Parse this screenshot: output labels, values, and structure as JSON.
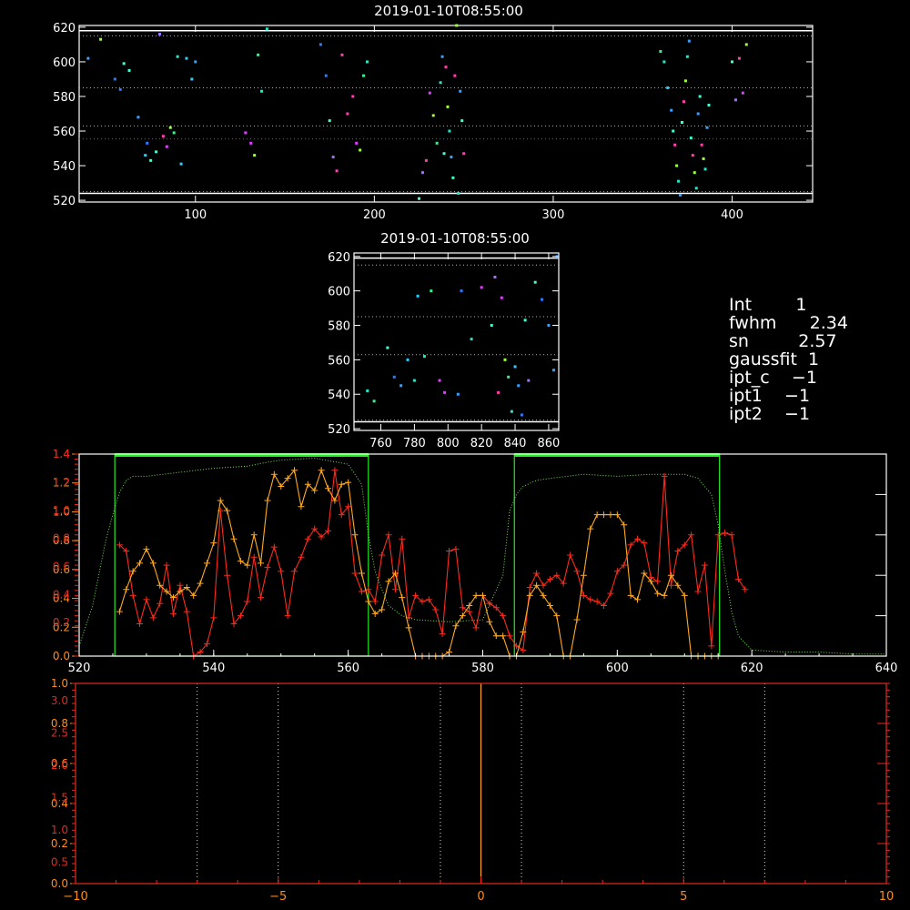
{
  "colors": {
    "background": "#000000",
    "axis_white": "#ffffff",
    "axis_orange": "#ff8c1a",
    "axis_red": "#e8281e",
    "series_red": "#ff2a1a",
    "series_orange": "#ffaa22",
    "dotted_green": "#7ce05a",
    "box_green": "#22ee22",
    "guide_yellow": "#ffe08a"
  },
  "info": {
    "int": "Int        1",
    "fwhm": "fwhm      2.34",
    "sn": "sn         2.57",
    "gaussfit": "gaussfit  1",
    "ipt_c": "ipt_c    −1",
    "ipt1": "ipt1    −1",
    "ipt2": "ipt2    −1"
  },
  "chart_data": [
    {
      "type": "scatter",
      "title": "2019-01-10T08:55:00",
      "xlim": [
        35,
        445
      ],
      "ylim": [
        519,
        621
      ],
      "x_ticks": [
        "100",
        "200",
        "300",
        "400"
      ],
      "x_tick_values": [
        100,
        200,
        300,
        400
      ],
      "y_ticks": [
        "520",
        "540",
        "560",
        "580",
        "600",
        "620"
      ],
      "y_tick_values": [
        520,
        540,
        560,
        580,
        600,
        620
      ],
      "hlines_white": [
        524,
        618
      ],
      "hlines_green_dotted": [
        615,
        585,
        563,
        525
      ],
      "hlines_red_dotted": [
        555.5
      ],
      "points": [
        [
          40,
          602
        ],
        [
          47,
          613
        ],
        [
          55,
          590
        ],
        [
          58,
          584
        ],
        [
          60,
          599
        ],
        [
          63,
          595
        ],
        [
          68,
          568
        ],
        [
          72,
          546
        ],
        [
          73,
          553
        ],
        [
          75,
          543
        ],
        [
          78,
          548
        ],
        [
          80,
          616
        ],
        [
          82,
          557
        ],
        [
          84,
          551
        ],
        [
          86,
          562
        ],
        [
          88,
          559
        ],
        [
          90,
          603
        ],
        [
          92,
          541
        ],
        [
          95,
          602
        ],
        [
          98,
          590
        ],
        [
          100,
          600
        ],
        [
          128,
          559
        ],
        [
          131,
          553
        ],
        [
          133,
          546
        ],
        [
          135,
          604
        ],
        [
          137,
          583
        ],
        [
          140,
          619
        ],
        [
          170,
          610
        ],
        [
          173,
          592
        ],
        [
          175,
          566
        ],
        [
          177,
          545
        ],
        [
          179,
          537
        ],
        [
          182,
          604
        ],
        [
          185,
          570
        ],
        [
          188,
          580
        ],
        [
          190,
          553
        ],
        [
          192,
          549
        ],
        [
          194,
          592
        ],
        [
          196,
          600
        ],
        [
          225,
          521
        ],
        [
          227,
          536
        ],
        [
          229,
          543
        ],
        [
          231,
          582
        ],
        [
          233,
          569
        ],
        [
          235,
          553
        ],
        [
          237,
          588
        ],
        [
          238,
          603
        ],
        [
          239,
          547
        ],
        [
          240,
          597
        ],
        [
          241,
          574
        ],
        [
          242,
          560
        ],
        [
          243,
          545
        ],
        [
          244,
          533
        ],
        [
          245,
          592
        ],
        [
          246,
          621
        ],
        [
          247,
          524
        ],
        [
          248,
          583
        ],
        [
          249,
          566
        ],
        [
          250,
          547
        ],
        [
          360,
          606
        ],
        [
          362,
          600
        ],
        [
          364,
          585
        ],
        [
          366,
          572
        ],
        [
          367,
          560
        ],
        [
          368,
          552
        ],
        [
          369,
          540
        ],
        [
          370,
          531
        ],
        [
          371,
          523
        ],
        [
          372,
          565
        ],
        [
          373,
          577
        ],
        [
          374,
          589
        ],
        [
          375,
          603
        ],
        [
          376,
          612
        ],
        [
          377,
          556
        ],
        [
          378,
          546
        ],
        [
          379,
          536
        ],
        [
          380,
          527
        ],
        [
          381,
          570
        ],
        [
          382,
          580
        ],
        [
          383,
          552
        ],
        [
          384,
          544
        ],
        [
          385,
          538
        ],
        [
          386,
          562
        ],
        [
          387,
          575
        ],
        [
          400,
          600
        ],
        [
          402,
          578
        ],
        [
          404,
          602
        ],
        [
          406,
          582
        ],
        [
          408,
          610
        ]
      ]
    },
    {
      "type": "scatter",
      "title": "2019-01-10T08:55:00",
      "xlim": [
        744,
        866
      ],
      "ylim": [
        519,
        622
      ],
      "x_ticks": [
        "760",
        "780",
        "800",
        "820",
        "840",
        "860"
      ],
      "x_tick_values": [
        760,
        780,
        800,
        820,
        840,
        860
      ],
      "y_ticks": [
        "520",
        "540",
        "560",
        "580",
        "600",
        "620"
      ],
      "y_tick_values": [
        520,
        540,
        560,
        580,
        600,
        620
      ],
      "hlines_white": [
        524,
        619
      ],
      "hlines_green_dotted": [
        615,
        585,
        563,
        525
      ],
      "points": [
        [
          752,
          542
        ],
        [
          756,
          536
        ],
        [
          764,
          567
        ],
        [
          768,
          550
        ],
        [
          772,
          545
        ],
        [
          776,
          560
        ],
        [
          780,
          548
        ],
        [
          782,
          597
        ],
        [
          786,
          562
        ],
        [
          790,
          600
        ],
        [
          795,
          548
        ],
        [
          798,
          541
        ],
        [
          806,
          540
        ],
        [
          808,
          600
        ],
        [
          814,
          572
        ],
        [
          820,
          602
        ],
        [
          826,
          580
        ],
        [
          828,
          608
        ],
        [
          830,
          541
        ],
        [
          832,
          596
        ],
        [
          834,
          560
        ],
        [
          836,
          550
        ],
        [
          838,
          530
        ],
        [
          840,
          556
        ],
        [
          842,
          545
        ],
        [
          844,
          528
        ],
        [
          846,
          583
        ],
        [
          848,
          548
        ],
        [
          852,
          605
        ],
        [
          856,
          595
        ],
        [
          860,
          580
        ],
        [
          863,
          554
        ],
        [
          865,
          620
        ]
      ]
    },
    {
      "type": "line",
      "xlim": [
        520,
        640
      ],
      "ylim": [
        0,
        1.0
      ],
      "x_ticks": [
        "520",
        "540",
        "560",
        "580",
        "600",
        "620",
        "640"
      ],
      "x_tick_values": [
        520,
        540,
        560,
        580,
        600,
        620,
        640
      ],
      "y_ticks_left_orange": [
        "0.0",
        "0.2",
        "0.4",
        "0.6",
        "0.8",
        "1.0",
        "1.2",
        "1.4"
      ],
      "y_ticks_left_red": [
        "0.2",
        "0.4",
        "0.6",
        "0.8",
        "1.0",
        "1.2",
        "1.4"
      ],
      "boxes": [
        [
          525.3,
          563.0
        ],
        [
          584.7,
          615.2
        ]
      ],
      "series": [
        {
          "color": "red",
          "x": [
            526,
            527,
            528,
            529,
            530,
            531,
            532,
            533,
            534,
            535,
            536,
            537,
            538,
            539,
            540,
            541,
            542,
            543,
            544,
            545,
            546,
            547,
            548,
            549,
            550,
            551,
            552,
            553,
            554,
            555,
            556,
            557,
            558,
            559,
            560,
            561,
            562,
            563,
            564,
            565,
            566,
            567,
            568,
            569,
            570,
            571,
            572,
            573,
            574,
            575,
            576,
            577,
            578,
            579,
            580,
            581,
            582,
            583,
            584,
            585,
            586,
            587,
            588,
            589,
            590,
            591,
            592,
            593,
            594,
            595,
            596,
            597,
            598,
            599,
            600,
            601,
            602,
            603,
            604,
            605,
            606,
            607,
            608,
            609,
            610,
            611,
            612,
            613,
            614,
            615,
            616,
            617,
            618,
            619
          ],
          "y": [
            0.55,
            0.52,
            0.3,
            0.16,
            0.28,
            0.19,
            0.26,
            0.45,
            0.21,
            0.35,
            0.22,
            0.0,
            0.02,
            0.06,
            0.19,
            0.72,
            0.4,
            0.16,
            0.2,
            0.27,
            0.49,
            0.29,
            0.44,
            0.54,
            0.42,
            0.2,
            0.42,
            0.49,
            0.58,
            0.63,
            0.59,
            0.62,
            0.92,
            0.7,
            0.74,
            0.41,
            0.32,
            0.33,
            0.27,
            0.5,
            0.6,
            0.33,
            0.58,
            0.19,
            0.3,
            0.27,
            0.28,
            0.23,
            0.11,
            0.52,
            0.53,
            0.24,
            0.22,
            0.14,
            0.3,
            0.26,
            0.24,
            0.2,
            0.1,
            0.05,
            0.03,
            0.34,
            0.41,
            0.35,
            0.38,
            0.4,
            0.36,
            0.5,
            0.42,
            0.3,
            0.28,
            0.27,
            0.25,
            0.31,
            0.42,
            0.45,
            0.55,
            0.58,
            0.56,
            0.39,
            0.37,
            0.89,
            0.35,
            0.52,
            0.55,
            0.6,
            0.32,
            0.45,
            0.05,
            0.6,
            0.61,
            0.6,
            0.38,
            0.33
          ]
        },
        {
          "color": "orange",
          "x": [
            526,
            527,
            528,
            529,
            530,
            531,
            532,
            533,
            534,
            535,
            536,
            537,
            538,
            539,
            540,
            541,
            542,
            543,
            544,
            545,
            546,
            547,
            548,
            549,
            550,
            551,
            552,
            553,
            554,
            555,
            556,
            557,
            558,
            559,
            560,
            561,
            562,
            563,
            564,
            565,
            566,
            567,
            568,
            569,
            570,
            571,
            572,
            573,
            574,
            575,
            576,
            577,
            578,
            579,
            580,
            581,
            582,
            583,
            584,
            585,
            586,
            587,
            588,
            589,
            590,
            591,
            592,
            593,
            594,
            595,
            596,
            597,
            598,
            599,
            600,
            601,
            602,
            603,
            604,
            605,
            606,
            607,
            608,
            609,
            610,
            611,
            612,
            613,
            614,
            615
          ],
          "y": [
            0.22,
            0.33,
            0.42,
            0.46,
            0.53,
            0.46,
            0.35,
            0.32,
            0.29,
            0.32,
            0.34,
            0.3,
            0.36,
            0.46,
            0.56,
            0.77,
            0.72,
            0.58,
            0.47,
            0.45,
            0.6,
            0.46,
            0.77,
            0.9,
            0.84,
            0.88,
            0.92,
            0.74,
            0.85,
            0.82,
            0.92,
            0.83,
            0.77,
            0.85,
            0.86,
            0.6,
            0.41,
            0.27,
            0.21,
            0.23,
            0.37,
            0.41,
            0.29,
            0.14,
            0.0,
            0.0,
            0.0,
            0.0,
            0.0,
            0.02,
            0.15,
            0.2,
            0.25,
            0.3,
            0.3,
            0.17,
            0.1,
            0.1,
            0.0,
            0.0,
            0.12,
            0.3,
            0.35,
            0.3,
            0.25,
            0.2,
            0.0,
            0.0,
            0.18,
            0.4,
            0.63,
            0.7,
            0.7,
            0.7,
            0.7,
            0.65,
            0.3,
            0.28,
            0.41,
            0.37,
            0.31,
            0.3,
            0.4,
            0.35,
            0.3,
            0.0,
            0.0,
            0.0,
            0.0,
            0.0
          ]
        },
        {
          "color": "green-dotted",
          "x": [
            520,
            522,
            524,
            525,
            526,
            527,
            528,
            530,
            535,
            540,
            545,
            548,
            550,
            555,
            560,
            562,
            563,
            564,
            565,
            566,
            568,
            570,
            575,
            580,
            583,
            584,
            585,
            586,
            588,
            590,
            595,
            600,
            605,
            610,
            612,
            614,
            615,
            616,
            617,
            618,
            620,
            625,
            630,
            635,
            640
          ],
          "y": [
            0.05,
            0.25,
            0.58,
            0.7,
            0.81,
            0.87,
            0.89,
            0.89,
            0.91,
            0.93,
            0.94,
            0.96,
            0.97,
            0.98,
            0.95,
            0.85,
            0.6,
            0.42,
            0.33,
            0.25,
            0.2,
            0.18,
            0.17,
            0.18,
            0.4,
            0.72,
            0.8,
            0.84,
            0.87,
            0.88,
            0.9,
            0.89,
            0.9,
            0.9,
            0.88,
            0.8,
            0.65,
            0.42,
            0.22,
            0.1,
            0.03,
            0.02,
            0.02,
            0.01,
            0.01
          ]
        }
      ]
    },
    {
      "type": "line",
      "xlim": [
        -10,
        10
      ],
      "ylim": [
        0,
        1.0
      ],
      "x_ticks": [
        "−10",
        "−5",
        "0",
        "5",
        "10"
      ],
      "x_tick_values": [
        -10,
        -5,
        0,
        5,
        10
      ],
      "y_ticks_left_orange": [
        "0.0",
        "0.2",
        "0.4",
        "0.6",
        "0.8",
        "1.0"
      ],
      "y_ticks_left_red": [
        "0.5",
        "1.0",
        "1.5",
        "2.0",
        "2.5",
        "3.0"
      ],
      "vlines_dotted": [
        -7,
        -5,
        -1,
        1,
        5,
        7
      ],
      "vline_solid": [
        0
      ]
    }
  ]
}
